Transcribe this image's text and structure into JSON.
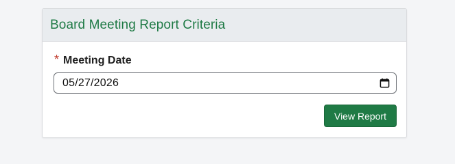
{
  "card": {
    "title": "Board Meeting Report Criteria"
  },
  "form": {
    "required_marker": "*",
    "meeting_date_label": "Meeting Date",
    "meeting_date_value": "05/27/2026",
    "calendar_icon": "calendar-icon",
    "view_report_label": "View Report"
  },
  "colors": {
    "title_green": "#1e7a45",
    "button_green": "#1f7a45",
    "required_red": "#c0392b",
    "header_bg": "#e9ecef"
  }
}
